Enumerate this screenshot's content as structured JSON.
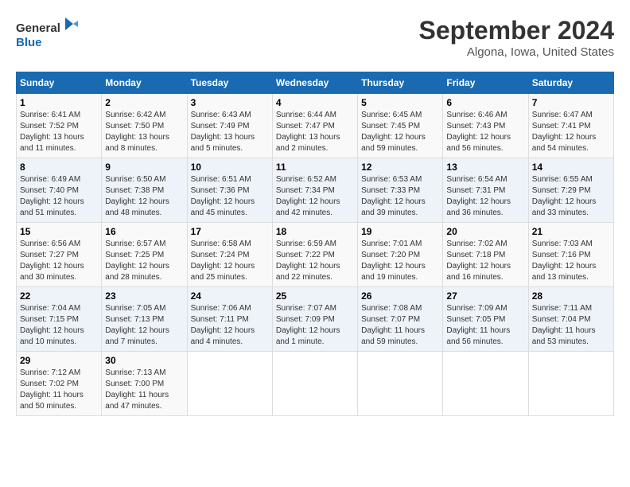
{
  "logo": {
    "line1": "General",
    "line2": "Blue"
  },
  "title": "September 2024",
  "location": "Algona, Iowa, United States",
  "days_of_week": [
    "Sunday",
    "Monday",
    "Tuesday",
    "Wednesday",
    "Thursday",
    "Friday",
    "Saturday"
  ],
  "weeks": [
    [
      {
        "day": "1",
        "info": "Sunrise: 6:41 AM\nSunset: 7:52 PM\nDaylight: 13 hours\nand 11 minutes."
      },
      {
        "day": "2",
        "info": "Sunrise: 6:42 AM\nSunset: 7:50 PM\nDaylight: 13 hours\nand 8 minutes."
      },
      {
        "day": "3",
        "info": "Sunrise: 6:43 AM\nSunset: 7:49 PM\nDaylight: 13 hours\nand 5 minutes."
      },
      {
        "day": "4",
        "info": "Sunrise: 6:44 AM\nSunset: 7:47 PM\nDaylight: 13 hours\nand 2 minutes."
      },
      {
        "day": "5",
        "info": "Sunrise: 6:45 AM\nSunset: 7:45 PM\nDaylight: 12 hours\nand 59 minutes."
      },
      {
        "day": "6",
        "info": "Sunrise: 6:46 AM\nSunset: 7:43 PM\nDaylight: 12 hours\nand 56 minutes."
      },
      {
        "day": "7",
        "info": "Sunrise: 6:47 AM\nSunset: 7:41 PM\nDaylight: 12 hours\nand 54 minutes."
      }
    ],
    [
      {
        "day": "8",
        "info": "Sunrise: 6:49 AM\nSunset: 7:40 PM\nDaylight: 12 hours\nand 51 minutes."
      },
      {
        "day": "9",
        "info": "Sunrise: 6:50 AM\nSunset: 7:38 PM\nDaylight: 12 hours\nand 48 minutes."
      },
      {
        "day": "10",
        "info": "Sunrise: 6:51 AM\nSunset: 7:36 PM\nDaylight: 12 hours\nand 45 minutes."
      },
      {
        "day": "11",
        "info": "Sunrise: 6:52 AM\nSunset: 7:34 PM\nDaylight: 12 hours\nand 42 minutes."
      },
      {
        "day": "12",
        "info": "Sunrise: 6:53 AM\nSunset: 7:33 PM\nDaylight: 12 hours\nand 39 minutes."
      },
      {
        "day": "13",
        "info": "Sunrise: 6:54 AM\nSunset: 7:31 PM\nDaylight: 12 hours\nand 36 minutes."
      },
      {
        "day": "14",
        "info": "Sunrise: 6:55 AM\nSunset: 7:29 PM\nDaylight: 12 hours\nand 33 minutes."
      }
    ],
    [
      {
        "day": "15",
        "info": "Sunrise: 6:56 AM\nSunset: 7:27 PM\nDaylight: 12 hours\nand 30 minutes."
      },
      {
        "day": "16",
        "info": "Sunrise: 6:57 AM\nSunset: 7:25 PM\nDaylight: 12 hours\nand 28 minutes."
      },
      {
        "day": "17",
        "info": "Sunrise: 6:58 AM\nSunset: 7:24 PM\nDaylight: 12 hours\nand 25 minutes."
      },
      {
        "day": "18",
        "info": "Sunrise: 6:59 AM\nSunset: 7:22 PM\nDaylight: 12 hours\nand 22 minutes."
      },
      {
        "day": "19",
        "info": "Sunrise: 7:01 AM\nSunset: 7:20 PM\nDaylight: 12 hours\nand 19 minutes."
      },
      {
        "day": "20",
        "info": "Sunrise: 7:02 AM\nSunset: 7:18 PM\nDaylight: 12 hours\nand 16 minutes."
      },
      {
        "day": "21",
        "info": "Sunrise: 7:03 AM\nSunset: 7:16 PM\nDaylight: 12 hours\nand 13 minutes."
      }
    ],
    [
      {
        "day": "22",
        "info": "Sunrise: 7:04 AM\nSunset: 7:15 PM\nDaylight: 12 hours\nand 10 minutes."
      },
      {
        "day": "23",
        "info": "Sunrise: 7:05 AM\nSunset: 7:13 PM\nDaylight: 12 hours\nand 7 minutes."
      },
      {
        "day": "24",
        "info": "Sunrise: 7:06 AM\nSunset: 7:11 PM\nDaylight: 12 hours\nand 4 minutes."
      },
      {
        "day": "25",
        "info": "Sunrise: 7:07 AM\nSunset: 7:09 PM\nDaylight: 12 hours\nand 1 minute."
      },
      {
        "day": "26",
        "info": "Sunrise: 7:08 AM\nSunset: 7:07 PM\nDaylight: 11 hours\nand 59 minutes."
      },
      {
        "day": "27",
        "info": "Sunrise: 7:09 AM\nSunset: 7:05 PM\nDaylight: 11 hours\nand 56 minutes."
      },
      {
        "day": "28",
        "info": "Sunrise: 7:11 AM\nSunset: 7:04 PM\nDaylight: 11 hours\nand 53 minutes."
      }
    ],
    [
      {
        "day": "29",
        "info": "Sunrise: 7:12 AM\nSunset: 7:02 PM\nDaylight: 11 hours\nand 50 minutes."
      },
      {
        "day": "30",
        "info": "Sunrise: 7:13 AM\nSunset: 7:00 PM\nDaylight: 11 hours\nand 47 minutes."
      },
      {
        "day": "",
        "info": ""
      },
      {
        "day": "",
        "info": ""
      },
      {
        "day": "",
        "info": ""
      },
      {
        "day": "",
        "info": ""
      },
      {
        "day": "",
        "info": ""
      }
    ]
  ]
}
